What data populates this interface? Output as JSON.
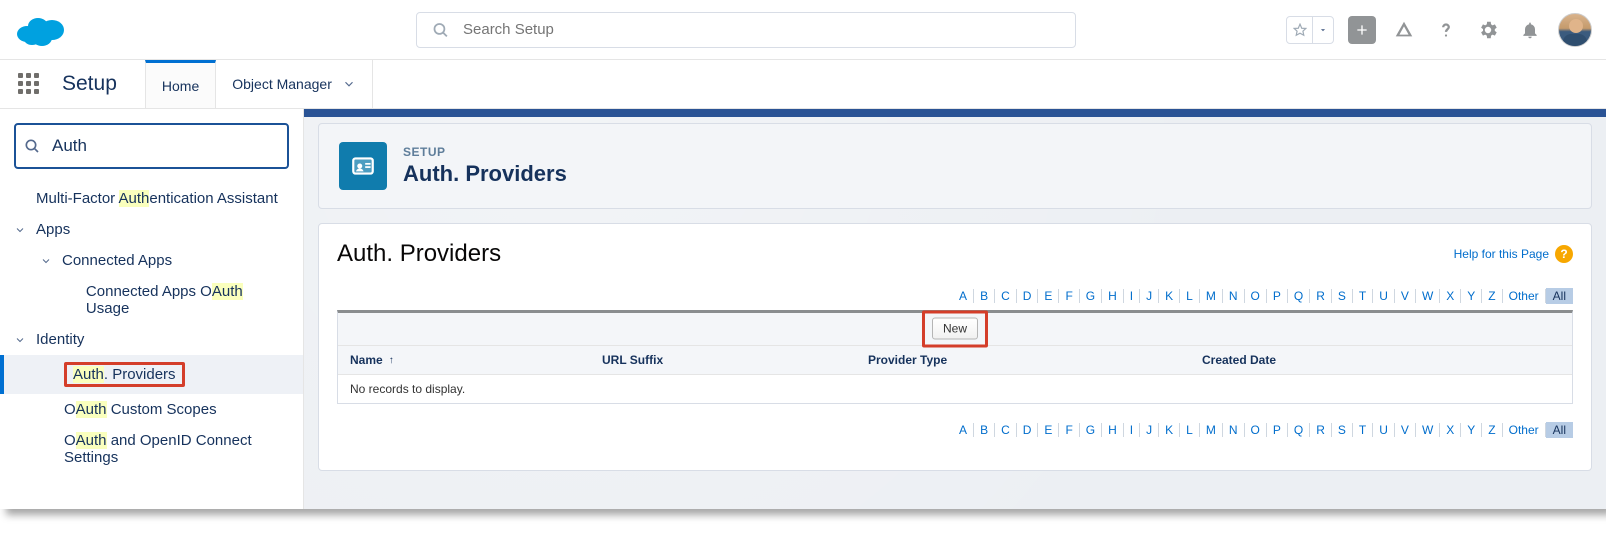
{
  "header": {
    "search_placeholder": "Search Setup"
  },
  "subnav": {
    "app_name": "Setup",
    "tab_home": "Home",
    "tab_object_manager": "Object Manager"
  },
  "sidebar": {
    "search_value": "Auth",
    "mfa_pre": "Multi-Factor ",
    "mfa_hl": "Auth",
    "mfa_post": "entication Assistant",
    "apps": "Apps",
    "connected_apps": "Connected Apps",
    "cau_pre": "Connected Apps O",
    "cau_hl": "Auth",
    "cau_post": " Usage",
    "identity": "Identity",
    "ap_hl": "Auth",
    "ap_post": ". Providers",
    "ocs_pre": "O",
    "ocs_hl": "Auth",
    "ocs_post": " Custom Scopes",
    "ooc_pre": "O",
    "ooc_hl": "Auth",
    "ooc_post": " and OpenID Connect Settings"
  },
  "page": {
    "eyebrow": "SETUP",
    "title": "Auth. Providers",
    "content_title": "Auth. Providers",
    "help_text": "Help for this Page",
    "new_button": "New",
    "columns": {
      "name": "Name",
      "url_suffix": "URL Suffix",
      "provider_type": "Provider Type",
      "created_date": "Created Date"
    },
    "empty_message": "No records to display."
  },
  "alpha": {
    "letters": [
      "A",
      "B",
      "C",
      "D",
      "E",
      "F",
      "G",
      "H",
      "I",
      "J",
      "K",
      "L",
      "M",
      "N",
      "O",
      "P",
      "Q",
      "R",
      "S",
      "T",
      "U",
      "V",
      "W",
      "X",
      "Y",
      "Z"
    ],
    "other": "Other",
    "all": "All"
  }
}
